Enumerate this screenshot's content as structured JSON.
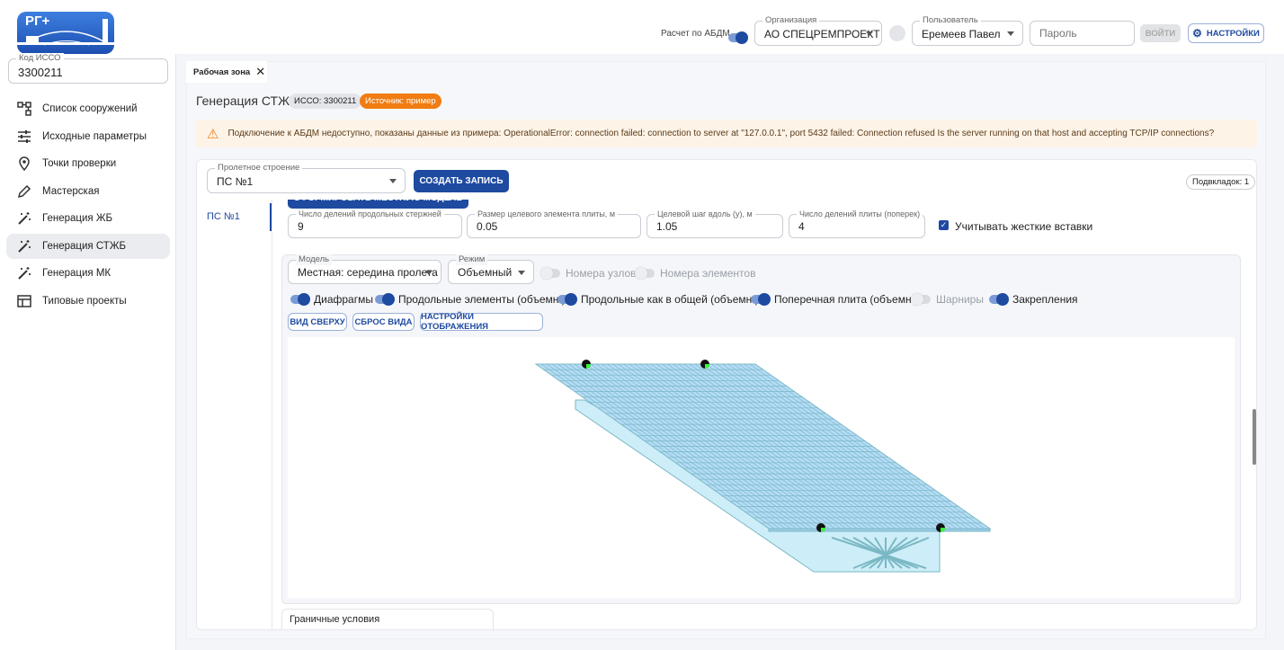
{
  "app": {
    "logo_text": "РГ+"
  },
  "sidebar": {
    "isso_label": "Код ИССО",
    "isso_value": "3300211",
    "items": [
      {
        "label": "Список сооружений",
        "icon": "structure-list-icon"
      },
      {
        "label": "Исходные параметры",
        "icon": "sliders-icon"
      },
      {
        "label": "Точки проверки",
        "icon": "map-pin-icon"
      },
      {
        "label": "Мастерская",
        "icon": "pencil-icon"
      },
      {
        "label": "Генерация ЖБ",
        "icon": "magic-wand-icon"
      },
      {
        "label": "Генерация СТЖБ",
        "icon": "magic-wand-icon",
        "active": true
      },
      {
        "label": "Генерация МК",
        "icon": "magic-wand-icon"
      },
      {
        "label": "Типовые проекты",
        "icon": "table-icon"
      }
    ]
  },
  "header": {
    "abdm_label": "Расчет по АБДМ",
    "abdm_on": true,
    "org_label": "Организация",
    "org_value": "АО СПЕЦРЕМПРОЕКТ",
    "user_label": "Пользователь",
    "user_value": "Еремеев Павел",
    "password_placeholder": "Пароль",
    "login_label": "ВОЙТИ",
    "settings_label": "НАСТРОЙКИ"
  },
  "workspace": {
    "tab_label": "Рабочая зона",
    "title": "Генерация СТЖБ",
    "isso_badge": "ИССО: 3300211",
    "source_badge": "Источник: пример",
    "alert": "Подключение к АБДМ недоступно, показаны данные из примера: OperationalError: connection failed: connection to server at \"127.0.0.1\", port 5432 failed: Connection refused Is the server running on that host and accepting TCP/IP connections?",
    "span_label": "Пролетное строение",
    "span_value": "ПС №1",
    "create_label": "СОЗДАТЬ ЗАПИСЬ",
    "subtabs_count": "Подвкладок: 1",
    "subtab": "ПС №1",
    "form_model_label": "СФОРМИРОВАТЬ МЕСТНУЮ МОДЕЛЬ",
    "params": [
      {
        "label": "Число делений продольных стержней",
        "value": "9"
      },
      {
        "label": "Размер целевого элемента плиты, м",
        "value": "0.05"
      },
      {
        "label": "Целевой шаг вдоль (y), м",
        "value": "1.05"
      },
      {
        "label": "Число делений плиты (поперек)",
        "value": "4"
      }
    ],
    "rigid_label": "Учитывать жесткие вставки",
    "rigid_checked": true,
    "model_label": "Модель",
    "model_value": "Местная: середина пролета",
    "mode_label": "Режим",
    "mode_value": "Объемный",
    "toggles": [
      {
        "label": "Номера узлов",
        "on": false
      },
      {
        "label": "Номера элементов",
        "on": false
      },
      {
        "label": "Диафрагмы",
        "on": true
      },
      {
        "label": "Продольные элементы (объемн.)",
        "on": true
      },
      {
        "label": "Продольные как в общей (объемн.)",
        "on": true
      },
      {
        "label": "Поперечная плита (объемн.)",
        "on": true
      },
      {
        "label": "Шарниры",
        "on": false
      },
      {
        "label": "Закрепления",
        "on": true
      }
    ],
    "view_buttons": [
      "ВИД СВЕРХУ",
      "СБРОС ВИДА",
      "НАСТРОЙКИ ОТОБРАЖЕНИЯ"
    ],
    "boundary_label": "Граничные условия"
  },
  "colors": {
    "accent": "#1e4aa0",
    "badge_orange": "#f07c12",
    "alert_bg": "#fdf3e7"
  }
}
